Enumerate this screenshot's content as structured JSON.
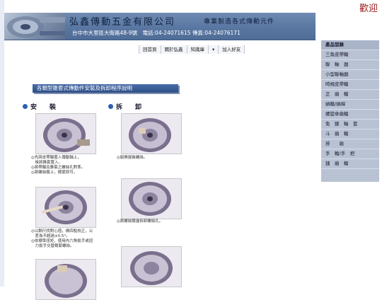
{
  "welcome": "歡迎",
  "header": {
    "company": "弘鑫傳動五金有限公司",
    "slogan": "專業製造各式傳動元件",
    "address": "台中市大里區大衛路48-9號　電話:04-24071615 傳真:04-24076171"
  },
  "nav": {
    "items": [
      "回首頁",
      "關於弘鑫",
      "知識庫",
      "▾",
      "加入好友"
    ]
  },
  "sidebar": {
    "items": [
      "產品型錄",
      "三角皮帶輪",
      "聯　軸　器",
      "小型聯軸器",
      "時規皮帶輪",
      "正　齒　輪",
      "蝸輪/蝸桿",
      "螺旋傘齒輪",
      "免　鍵　軸　套",
      "斗　齒　輪",
      "排　　齒",
      "手　輪/手　把",
      "鏈　齒　輪"
    ]
  },
  "main": {
    "title": "各類型錐套式傳動件安裝及拆卸程序說明",
    "install_heading": "安　　裝",
    "remove_heading": "拆　　卸",
    "install_steps": [
      [
        "◎先將皮帶輪置入傳動軸上，",
        "　後將錐套置入。",
        "◎將帶輪及錐套之螺絲孔對準。",
        "◎將螺絲鎖上，微緊即可。"
      ],
      [
        "◎以鋼尺找對心值，做四點校正，公",
        "　差為不超過±0.5°。",
        "◎依標準扭矩，使用內六角扳手或扭",
        "　力扳手交替鎖緊螺絲。"
      ]
    ],
    "remove_steps": [
      [
        "◎鬆開拔裝螺絲。"
      ],
      [
        "◎將螺絲鎖進拆卸螺絲孔。"
      ]
    ]
  },
  "colors": {
    "header_blue": "#5a77a2",
    "title_bar": "#2e4f86",
    "sidebar": "#b8c2d3",
    "welcome_red": "#9a1a1a"
  }
}
